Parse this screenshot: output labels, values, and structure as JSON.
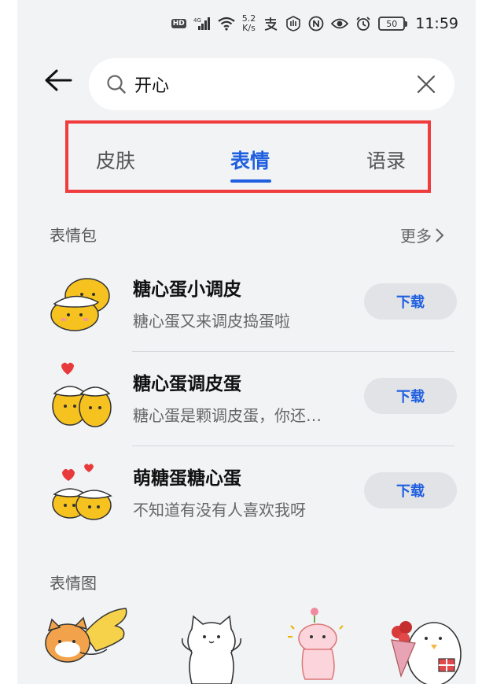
{
  "status_bar": {
    "hd": "HD",
    "network": "4G",
    "speed_value": "5.2",
    "speed_unit": "K/s",
    "battery": "50",
    "time": "11:59"
  },
  "search": {
    "query": "开心",
    "placeholder": ""
  },
  "tabs": [
    {
      "label": "皮肤",
      "active": false
    },
    {
      "label": "表情",
      "active": true
    },
    {
      "label": "语录",
      "active": false
    }
  ],
  "sticker_packs_section": {
    "title": "表情包",
    "more_label": "更多"
  },
  "sticker_packs": [
    {
      "name": "糖心蛋小调皮",
      "description": "糖心蛋又来调皮捣蛋啦",
      "button": "下载"
    },
    {
      "name": "糖心蛋调皮蛋",
      "description": "糖心蛋是颗调皮蛋，你还…",
      "button": "下载"
    },
    {
      "name": "萌糖蛋糖心蛋",
      "description": "不知道有没有人喜欢我呀",
      "button": "下载"
    }
  ],
  "stickers_section": {
    "title": "表情图"
  },
  "stickers": [
    {
      "name": "cat-and-banana-sticker"
    },
    {
      "name": "white-cat-sticker"
    },
    {
      "name": "pink-creature-sticker"
    },
    {
      "name": "chick-with-flowers-sticker"
    }
  ],
  "colors": {
    "accent": "#1f5fe0",
    "highlight_frame": "#f03c3c",
    "background": "#f1f3f5",
    "button_bg": "#e1e3e6"
  }
}
